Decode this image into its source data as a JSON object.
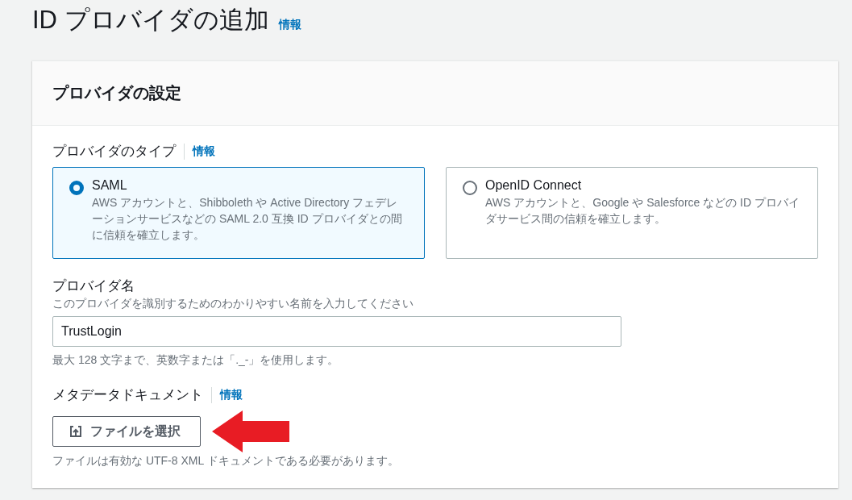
{
  "page": {
    "title": "ID プロバイダの追加",
    "info_link": "情報"
  },
  "panel": {
    "title": "プロバイダの設定",
    "provider_type": {
      "label": "プロバイダのタイプ",
      "info_link": "情報",
      "options": [
        {
          "title": "SAML",
          "description": "AWS アカウントと、Shibboleth や Active Directory フェデレーションサービスなどの SAML 2.0 互換 ID プロバイダとの間に信頼を確立します。",
          "selected": true
        },
        {
          "title": "OpenID Connect",
          "description": "AWS アカウントと、Google や Salesforce などの ID プロバイダサービス間の信頼を確立します。",
          "selected": false
        }
      ]
    },
    "provider_name": {
      "label": "プロバイダ名",
      "description": "このプロバイダを識別するためのわかりやすい名前を入力してください",
      "value": "TrustLogin",
      "constraint": "最大 128 文字まで、英数字または「._-」を使用します。"
    },
    "metadata_document": {
      "label": "メタデータドキュメント",
      "info_link": "情報",
      "button": "ファイルを選択",
      "constraint": "ファイルは有効な UTF-8 XML ドキュメントである必要があります。"
    }
  }
}
